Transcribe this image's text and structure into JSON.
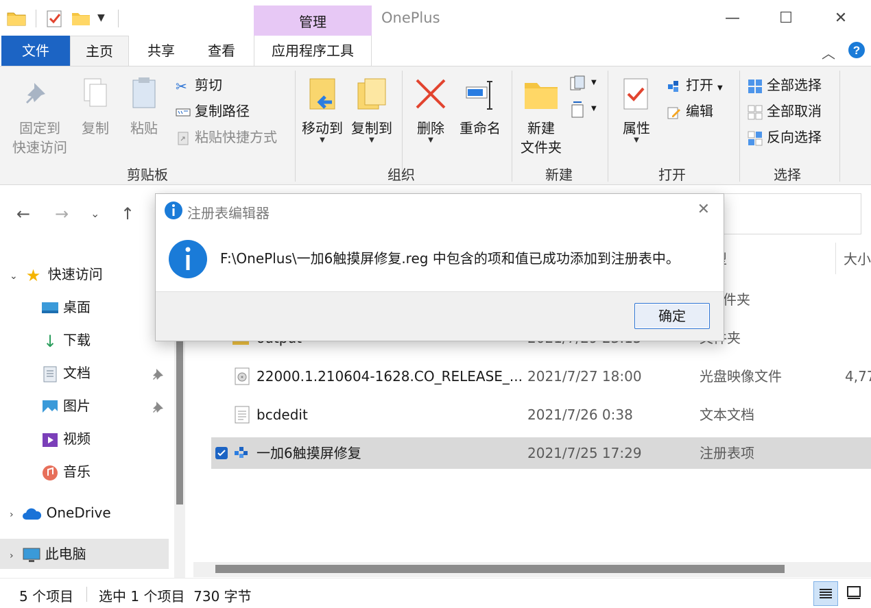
{
  "window": {
    "title": "OnePlus",
    "contextual_group": "管理",
    "controls": {
      "minimize": "—",
      "maximize": "☐",
      "close": "✕"
    }
  },
  "tabs": {
    "file": "文件",
    "home": "主页",
    "share": "共享",
    "view": "查看",
    "app_tools": "应用程序工具"
  },
  "ribbon": {
    "clipboard": {
      "label": "剪贴板",
      "pin_line1": "固定到",
      "pin_line2": "快速访问",
      "copy": "复制",
      "paste": "粘贴",
      "cut": "剪切",
      "copy_path": "复制路径",
      "paste_shortcut": "粘贴快捷方式"
    },
    "organize": {
      "label": "组织",
      "move_to": "移动到",
      "copy_to": "复制到",
      "delete": "删除",
      "rename": "重命名"
    },
    "new": {
      "label": "新建",
      "new_folder_line1": "新建",
      "new_folder_line2": "文件夹"
    },
    "open": {
      "label": "打开",
      "properties": "属性",
      "open": "打开",
      "edit": "编辑"
    },
    "select": {
      "label": "选择",
      "select_all": "全部选择",
      "select_none": "全部取消",
      "invert": "反向选择"
    }
  },
  "nav_pane": {
    "quick_access": "快速访问",
    "items": [
      {
        "label": "桌面"
      },
      {
        "label": "下载"
      },
      {
        "label": "文档"
      },
      {
        "label": "图片"
      },
      {
        "label": "视频"
      },
      {
        "label": "音乐"
      }
    ],
    "onedrive": "OneDrive",
    "this_pc": "此电脑"
  },
  "file_list": {
    "columns": {
      "type": "型",
      "size": "大小"
    },
    "rows": [
      {
        "name": "",
        "date": "",
        "type": "件夹",
        "size": ""
      },
      {
        "name": "output",
        "date": "2021/7/29 23:15",
        "type": "文件夹",
        "size": ""
      },
      {
        "name": "22000.1.210604-1628.CO_RELEASE_...",
        "date": "2021/7/27 18:00",
        "type": "光盘映像文件",
        "size": "4,77"
      },
      {
        "name": "bcdedit",
        "date": "2021/7/26 0:38",
        "type": "文本文档",
        "size": ""
      },
      {
        "name": "一加6触摸屏修复",
        "date": "2021/7/25 17:29",
        "type": "注册表项",
        "size": "",
        "selected": true
      }
    ]
  },
  "status": {
    "count": "5 个项目",
    "selection": "选中 1 个项目  730 字节"
  },
  "dialog": {
    "title": "注册表编辑器",
    "message": "F:\\OnePlus\\一加6触摸屏修复.reg 中包含的项和值已成功添加到注册表中。",
    "ok": "确定",
    "close": "✕"
  },
  "colors": {
    "file_tab": "#1c64c4",
    "manage_tab": "#e7c8f5",
    "ribbon_bg": "#f3f3f3",
    "selected_row": "#d9d9d9",
    "info_icon": "#1a7bd8"
  }
}
